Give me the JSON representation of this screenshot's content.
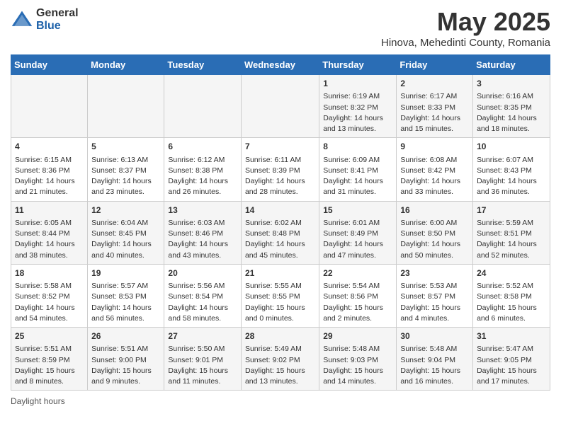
{
  "header": {
    "logo_general": "General",
    "logo_blue": "Blue",
    "title": "May 2025",
    "subtitle": "Hinova, Mehedinti County, Romania"
  },
  "days_of_week": [
    "Sunday",
    "Monday",
    "Tuesday",
    "Wednesday",
    "Thursday",
    "Friday",
    "Saturday"
  ],
  "weeks": [
    [
      {
        "day": "",
        "info": ""
      },
      {
        "day": "",
        "info": ""
      },
      {
        "day": "",
        "info": ""
      },
      {
        "day": "",
        "info": ""
      },
      {
        "day": "1",
        "info": "Sunrise: 6:19 AM\nSunset: 8:32 PM\nDaylight: 14 hours\nand 13 minutes."
      },
      {
        "day": "2",
        "info": "Sunrise: 6:17 AM\nSunset: 8:33 PM\nDaylight: 14 hours\nand 15 minutes."
      },
      {
        "day": "3",
        "info": "Sunrise: 6:16 AM\nSunset: 8:35 PM\nDaylight: 14 hours\nand 18 minutes."
      }
    ],
    [
      {
        "day": "4",
        "info": "Sunrise: 6:15 AM\nSunset: 8:36 PM\nDaylight: 14 hours\nand 21 minutes."
      },
      {
        "day": "5",
        "info": "Sunrise: 6:13 AM\nSunset: 8:37 PM\nDaylight: 14 hours\nand 23 minutes."
      },
      {
        "day": "6",
        "info": "Sunrise: 6:12 AM\nSunset: 8:38 PM\nDaylight: 14 hours\nand 26 minutes."
      },
      {
        "day": "7",
        "info": "Sunrise: 6:11 AM\nSunset: 8:39 PM\nDaylight: 14 hours\nand 28 minutes."
      },
      {
        "day": "8",
        "info": "Sunrise: 6:09 AM\nSunset: 8:41 PM\nDaylight: 14 hours\nand 31 minutes."
      },
      {
        "day": "9",
        "info": "Sunrise: 6:08 AM\nSunset: 8:42 PM\nDaylight: 14 hours\nand 33 minutes."
      },
      {
        "day": "10",
        "info": "Sunrise: 6:07 AM\nSunset: 8:43 PM\nDaylight: 14 hours\nand 36 minutes."
      }
    ],
    [
      {
        "day": "11",
        "info": "Sunrise: 6:05 AM\nSunset: 8:44 PM\nDaylight: 14 hours\nand 38 minutes."
      },
      {
        "day": "12",
        "info": "Sunrise: 6:04 AM\nSunset: 8:45 PM\nDaylight: 14 hours\nand 40 minutes."
      },
      {
        "day": "13",
        "info": "Sunrise: 6:03 AM\nSunset: 8:46 PM\nDaylight: 14 hours\nand 43 minutes."
      },
      {
        "day": "14",
        "info": "Sunrise: 6:02 AM\nSunset: 8:48 PM\nDaylight: 14 hours\nand 45 minutes."
      },
      {
        "day": "15",
        "info": "Sunrise: 6:01 AM\nSunset: 8:49 PM\nDaylight: 14 hours\nand 47 minutes."
      },
      {
        "day": "16",
        "info": "Sunrise: 6:00 AM\nSunset: 8:50 PM\nDaylight: 14 hours\nand 50 minutes."
      },
      {
        "day": "17",
        "info": "Sunrise: 5:59 AM\nSunset: 8:51 PM\nDaylight: 14 hours\nand 52 minutes."
      }
    ],
    [
      {
        "day": "18",
        "info": "Sunrise: 5:58 AM\nSunset: 8:52 PM\nDaylight: 14 hours\nand 54 minutes."
      },
      {
        "day": "19",
        "info": "Sunrise: 5:57 AM\nSunset: 8:53 PM\nDaylight: 14 hours\nand 56 minutes."
      },
      {
        "day": "20",
        "info": "Sunrise: 5:56 AM\nSunset: 8:54 PM\nDaylight: 14 hours\nand 58 minutes."
      },
      {
        "day": "21",
        "info": "Sunrise: 5:55 AM\nSunset: 8:55 PM\nDaylight: 15 hours\nand 0 minutes."
      },
      {
        "day": "22",
        "info": "Sunrise: 5:54 AM\nSunset: 8:56 PM\nDaylight: 15 hours\nand 2 minutes."
      },
      {
        "day": "23",
        "info": "Sunrise: 5:53 AM\nSunset: 8:57 PM\nDaylight: 15 hours\nand 4 minutes."
      },
      {
        "day": "24",
        "info": "Sunrise: 5:52 AM\nSunset: 8:58 PM\nDaylight: 15 hours\nand 6 minutes."
      }
    ],
    [
      {
        "day": "25",
        "info": "Sunrise: 5:51 AM\nSunset: 8:59 PM\nDaylight: 15 hours\nand 8 minutes."
      },
      {
        "day": "26",
        "info": "Sunrise: 5:51 AM\nSunset: 9:00 PM\nDaylight: 15 hours\nand 9 minutes."
      },
      {
        "day": "27",
        "info": "Sunrise: 5:50 AM\nSunset: 9:01 PM\nDaylight: 15 hours\nand 11 minutes."
      },
      {
        "day": "28",
        "info": "Sunrise: 5:49 AM\nSunset: 9:02 PM\nDaylight: 15 hours\nand 13 minutes."
      },
      {
        "day": "29",
        "info": "Sunrise: 5:48 AM\nSunset: 9:03 PM\nDaylight: 15 hours\nand 14 minutes."
      },
      {
        "day": "30",
        "info": "Sunrise: 5:48 AM\nSunset: 9:04 PM\nDaylight: 15 hours\nand 16 minutes."
      },
      {
        "day": "31",
        "info": "Sunrise: 5:47 AM\nSunset: 9:05 PM\nDaylight: 15 hours\nand 17 minutes."
      }
    ]
  ],
  "footer": {
    "daylight_label": "Daylight hours"
  }
}
